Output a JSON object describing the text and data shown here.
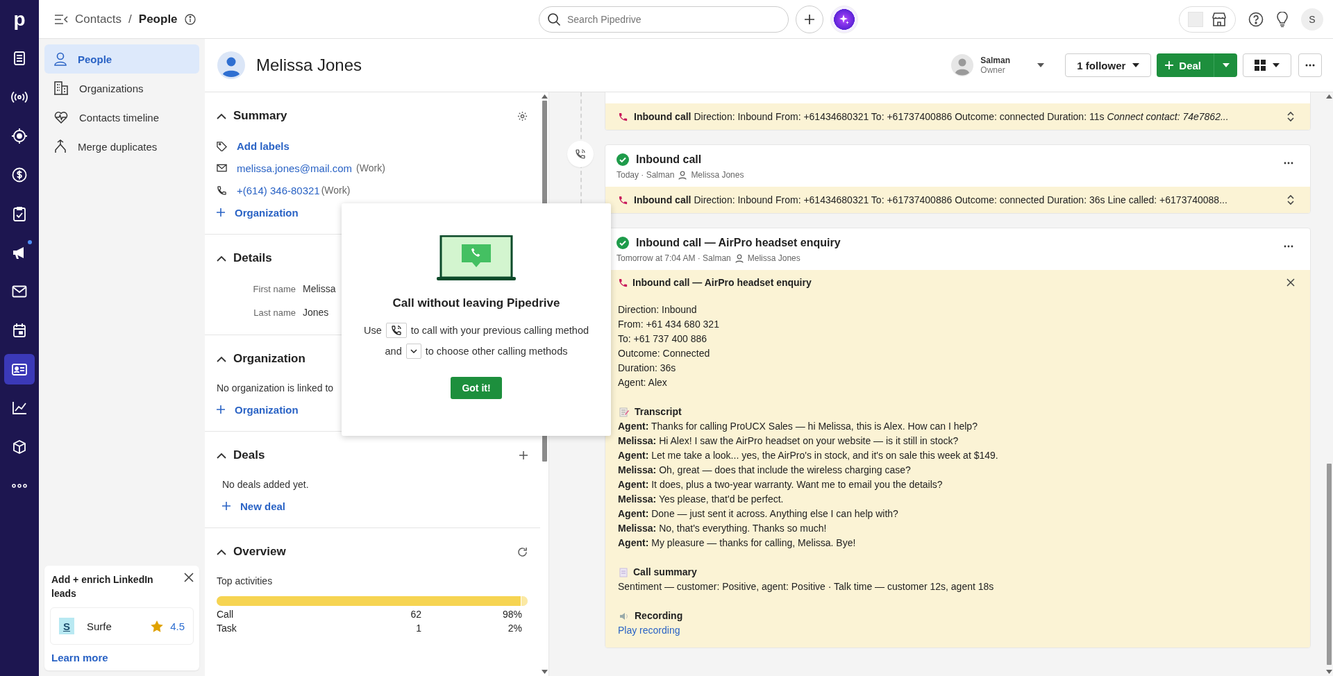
{
  "nav_rail": {
    "logo": "p",
    "items": [
      {
        "selected": false,
        "notification": false
      },
      {
        "selected": false,
        "notification": false
      },
      {
        "selected": false,
        "notification": false
      },
      {
        "selected": false,
        "notification": false
      },
      {
        "selected": false,
        "notification": false
      },
      {
        "selected": false,
        "notification": true
      },
      {
        "selected": false,
        "notification": false
      },
      {
        "selected": false,
        "notification": false
      },
      {
        "selected": true,
        "notification": false
      },
      {
        "selected": false,
        "notification": false
      },
      {
        "selected": false,
        "notification": false
      },
      {
        "selected": false,
        "notification": false
      }
    ]
  },
  "top_bar": {
    "breadcrumb": [
      "Contacts",
      "People"
    ],
    "separator": "/",
    "search": {
      "placeholder": "Search Pipedrive"
    },
    "avatar": "S"
  },
  "sidebar": {
    "items": [
      {
        "label": "People",
        "selected": true
      },
      {
        "label": "Organizations",
        "selected": false
      },
      {
        "label": "Contacts timeline",
        "selected": false
      },
      {
        "label": "Merge duplicates",
        "selected": false
      }
    ],
    "promo": {
      "title": "Add + enrich LinkedIn leads",
      "app": {
        "logo": "S",
        "name": "Surfe",
        "rating": "4.5"
      },
      "link": "Learn more"
    }
  },
  "person": {
    "name": "Melissa Jones",
    "owner": {
      "name": "Salman",
      "role": "Owner"
    },
    "followers": "1 follower",
    "deal_button": "Deal"
  },
  "summary": {
    "title": "Summary",
    "add_labels": "Add labels",
    "email": "melissa.jones@mail.com",
    "email_type": "(Work)",
    "phone": "+(614) 346-80321",
    "phone_type": "(Work)",
    "organization_link": "Organization"
  },
  "details": {
    "title": "Details",
    "fields": [
      {
        "label": "First name",
        "value": "Melissa"
      },
      {
        "label": "Last name",
        "value": "Jones"
      }
    ]
  },
  "organization": {
    "title": "Organization",
    "empty": "No organization is linked to",
    "link": "Organization"
  },
  "deals": {
    "title": "Deals",
    "empty": "No deals added yet.",
    "link": "New deal"
  },
  "overview": {
    "title": "Overview",
    "subtitle": "Top activities",
    "activities": [
      {
        "name": "Call",
        "count": "62",
        "share": "98%",
        "level": 0.98
      },
      {
        "name": "Task",
        "count": "1",
        "share": "2%",
        "level": 0.02
      }
    ]
  },
  "popup": {
    "title": "Call without leaving Pipedrive",
    "line_1": [
      "Use",
      "to call with your previous calling method"
    ],
    "line_2": [
      "and",
      "to choose other calling methods"
    ],
    "button": "Got it!"
  },
  "timeline": [
    {
      "kind": "note_only",
      "note": {
        "title": "Inbound call",
        "text": "Direction: Inbound From: +61434680321 To: +61737400886 Outcome: connected Duration: 11s",
        "extra": "Connect contact: 74e7862..."
      }
    },
    {
      "kind": "call",
      "title": "Inbound call",
      "done": true,
      "byline": "Today · Salman",
      "contact": "Melissa Jones",
      "note": {
        "title": "Inbound call",
        "text": "Direction: Inbound From: +61434680321 To: +61737400886 Outcome: connected Duration: 36s Line called: +6173740088..."
      }
    },
    {
      "kind": "expanded",
      "title": "Inbound call — AirPro headset enquiry",
      "done": true,
      "byline": "Tomorrow at 7:04 AM · Salman",
      "contact": "Melissa Jones",
      "note_title": "Inbound call — AirPro headset enquiry",
      "details": [
        "Direction: Inbound",
        "From: +61 434 680 321",
        "To: +61 737 400 886",
        "Outcome: Connected",
        "Duration: 36s",
        "Agent: Alex"
      ],
      "transcript_title": "Transcript",
      "transcript": [
        "**Agent:** Thanks for calling ProUCX Sales — hi Melissa, this is Alex. How can I help?",
        "**Melissa:** Hi Alex! I saw the AirPro headset on your website — is it still in stock?",
        "**Agent:** Let me take a look... yes, the AirPro's in stock, and it's on sale this week at $149.",
        "**Melissa:** Oh, great — does that include the wireless charging case?",
        "**Agent:** It does, plus a two-year warranty. Want me to email you the details?",
        "**Melissa:** Yes please, that'd be perfect.",
        "**Agent:** Done — just sent it across. Anything else I can help with?",
        "**Melissa:** No, that's everything. Thanks so much!",
        "**Agent:** My pleasure — thanks for calling, Melissa. Bye!"
      ],
      "summary_title": "Call summary",
      "summary": "Sentiment — customer: Positive, agent: Positive · Talk time — customer 12s, agent 18s",
      "recording_title": "Recording",
      "recording_link": "Play recording"
    }
  ]
}
